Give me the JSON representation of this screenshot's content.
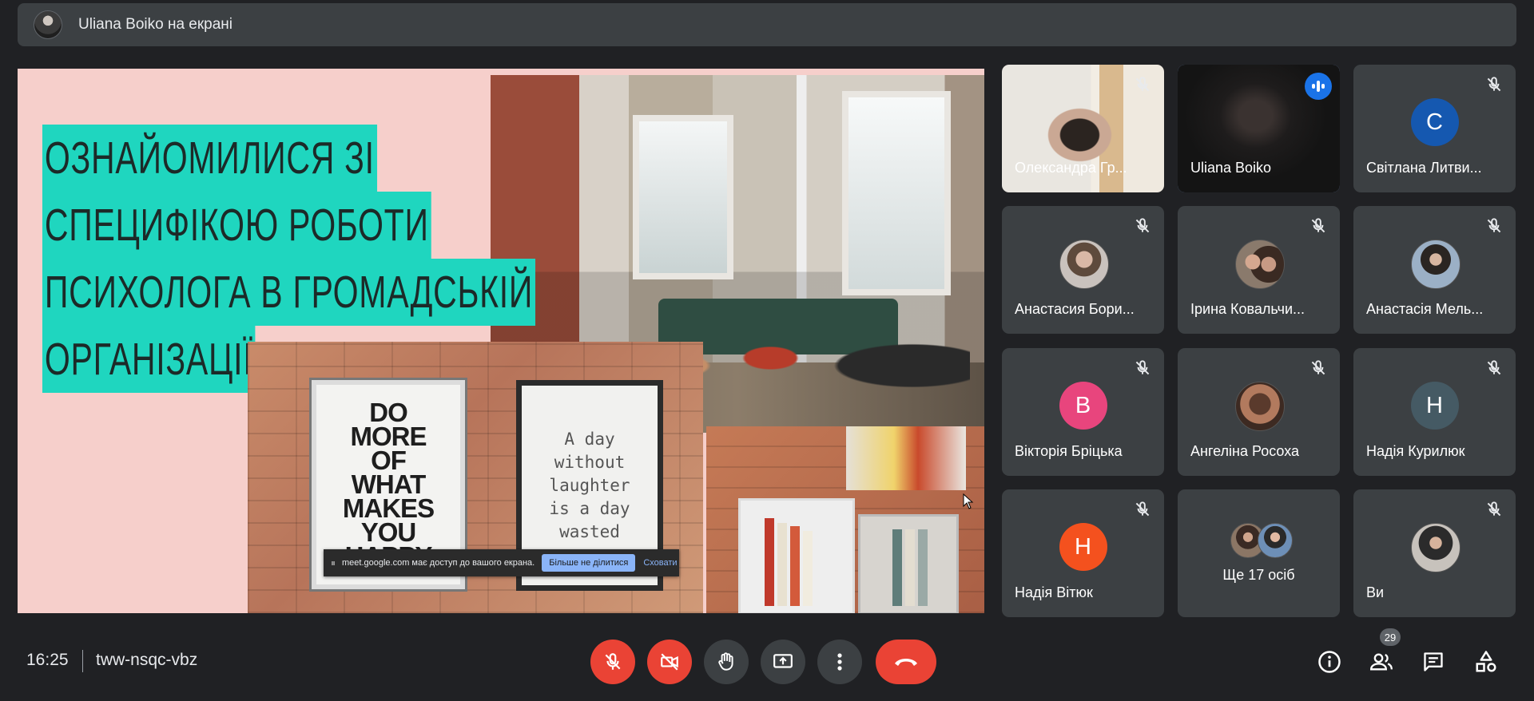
{
  "presenter_bar": {
    "label": "Uliana Boiko на екрані"
  },
  "slide": {
    "title_lines": [
      "ОЗНАЙОМИЛИСЯ ЗІ",
      "СПЕЦИФІКОЮ РОБОТИ",
      "ПСИХОЛОГА В ГРОМАДСЬКІЙ",
      "ОРГАНІЗАЦІЇ"
    ],
    "poster_left_text": "DO\nMORE\nOF\nWHAT\nMAKES\nYOU\nHAPPY",
    "poster_right_text": "A day\nwithout\nlaughter\nis a day\nwasted"
  },
  "share_banner": {
    "message": "meet.google.com має доступ до вашого екрана.",
    "stop_label": "Більше не ділитися",
    "hide_label": "Сховати"
  },
  "participants": [
    {
      "name": "Олександра Гр...",
      "kind": "video",
      "muted": true
    },
    {
      "name": "Uliana Boiko",
      "kind": "video",
      "muted": false,
      "speaking": true,
      "active": true
    },
    {
      "name": "Світлана Литви...",
      "kind": "letter",
      "initial": "C",
      "color": "#1558b0",
      "muted": true
    },
    {
      "name": "Анастасия Бори...",
      "kind": "photo",
      "muted": true
    },
    {
      "name": "Ірина Ковальчи...",
      "kind": "photo",
      "muted": true
    },
    {
      "name": "Анастасія Мель...",
      "kind": "photo",
      "muted": true
    },
    {
      "name": "Вікторія Бріцька",
      "kind": "letter",
      "initial": "B",
      "color": "#e8457d",
      "muted": true
    },
    {
      "name": "Ангеліна Росоха",
      "kind": "photo",
      "muted": true
    },
    {
      "name": "Надія Курилюк",
      "kind": "letter",
      "initial": "H",
      "color": "#455a64",
      "muted": true
    },
    {
      "name": "Надія Вітюк",
      "kind": "letter",
      "initial": "H",
      "color": "#f4511e",
      "muted": true
    },
    {
      "name": "Ще 17 осіб",
      "kind": "others",
      "muted": false
    },
    {
      "name": "Ви",
      "kind": "photo",
      "muted": true
    }
  ],
  "bottom": {
    "time": "16:25",
    "meeting_code": "tww-nsqc-vbz",
    "participant_count": "29"
  },
  "icons": {
    "mic": "mic-off-icon",
    "camera": "camera-off-icon",
    "hand": "raise-hand-icon",
    "present": "present-screen-icon",
    "more": "more-vert-icon",
    "hangup": "call-end-icon",
    "info": "info-icon",
    "people": "people-icon",
    "chat": "chat-icon",
    "activities": "activities-icon"
  },
  "colors": {
    "accent": "#8ab4f8",
    "danger": "#ea4335",
    "slide_highlight": "#1fd6bf"
  }
}
